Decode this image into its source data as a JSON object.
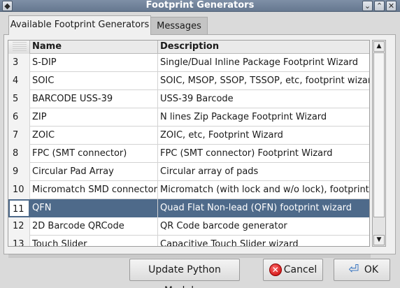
{
  "window": {
    "title": "Footprint Generators"
  },
  "tabs": [
    {
      "label": "Available Footprint Generators"
    },
    {
      "label": "Messages"
    }
  ],
  "table": {
    "columns": {
      "name": "Name",
      "description": "Description"
    },
    "rows": [
      {
        "num": "3",
        "name": "S-DIP",
        "desc": "Single/Dual Inline Package Footprint Wizard"
      },
      {
        "num": "4",
        "name": "SOIC",
        "desc": "SOIC, MSOP, SSOP, TSSOP, etc, footprint wizard"
      },
      {
        "num": "5",
        "name": "BARCODE USS-39",
        "desc": "USS-39 Barcode"
      },
      {
        "num": "6",
        "name": "ZIP",
        "desc": "N lines Zip Package Footprint Wizard"
      },
      {
        "num": "7",
        "name": "ZOIC",
        "desc": "ZOIC, etc, Footprint Wizard"
      },
      {
        "num": "8",
        "name": "FPC (SMT connector)",
        "desc": "FPC (SMT connector) Footprint Wizard"
      },
      {
        "num": "9",
        "name": "Circular Pad Array",
        "desc": "Circular array of pads"
      },
      {
        "num": "10",
        "name": "Micromatch SMD connectors",
        "desc": "Micromatch (with lock and w/o lock), footprint"
      },
      {
        "num": "11",
        "name": "QFN",
        "desc": "Quad Flat Non-lead (QFN) footprint wizard"
      },
      {
        "num": "12",
        "name": "2D Barcode QRCode",
        "desc": "QR Code barcode generator"
      },
      {
        "num": "13",
        "name": "Touch Slider",
        "desc": "Capacitive Touch Slider wizard"
      }
    ],
    "selected_row": "11"
  },
  "buttons": {
    "update": "Update Python Modules",
    "cancel": "Cancel",
    "ok": "OK"
  },
  "icons": {
    "close": "close-icon",
    "minimize": "chevron-down-icon",
    "maximize": "chevron-up-icon",
    "cancel": "cancel-icon",
    "ok": "enter-arrow-icon"
  },
  "colors": {
    "selection": "#4e6a8a",
    "titlebar": "#72849c"
  }
}
